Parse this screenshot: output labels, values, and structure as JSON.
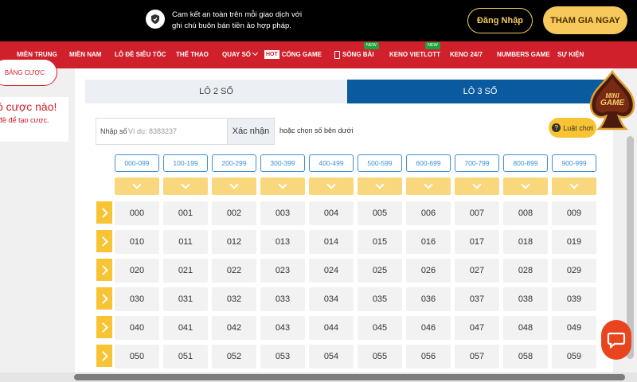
{
  "topbar": {
    "note": "Cam kết an toàn trên mỗi giao dịch với ghi chú buôn bán tiền ảo hợp pháp.",
    "login_label": "Đăng Nhập",
    "join_label": "THAM GIA NGAY",
    "accent": "#f7c95a"
  },
  "nav": {
    "bg": "#d0202b",
    "items": [
      {
        "label": "MIỀN TRUNG"
      },
      {
        "label": "MIỀN NAM"
      },
      {
        "label": "LÔ ĐỀ SIÊU TỐC"
      },
      {
        "label": "THỂ THAO"
      },
      {
        "label": "QUAY SỐ"
      },
      {
        "label": "CỔNG GAME",
        "tag": "HOT"
      },
      {
        "label": "SÒNG BÀI",
        "badge": "NEW"
      },
      {
        "label": "KENO VIETLOTT",
        "badge": "NEW"
      },
      {
        "label": "KENO 24/7"
      },
      {
        "label": "NUMBERS GAME"
      },
      {
        "label": "SỰ KIỆN"
      }
    ]
  },
  "sidebar": {
    "button_label": "BẢNG CƯỢC",
    "heading": "ó cược nào!",
    "subtext": "đề để tạo cược."
  },
  "tabs": [
    {
      "label": "LÔ 2 SỐ",
      "active": false
    },
    {
      "label": "LÔ 3 SỐ",
      "active": true
    }
  ],
  "input": {
    "label": "Nhập số",
    "placeholder": "Ví dụ: 8383237",
    "value": "",
    "confirm_label": "Xác nhận",
    "hint": "hoặc chọn số bên dưới"
  },
  "rules_label": "Luật chơi",
  "ranges": [
    "000-099",
    "100-199",
    "200-299",
    "300-399",
    "400-499",
    "500-599",
    "600-699",
    "700-799",
    "800-899",
    "900-999"
  ],
  "grid": [
    [
      "000",
      "001",
      "002",
      "003",
      "004",
      "005",
      "006",
      "007",
      "008",
      "009"
    ],
    [
      "010",
      "011",
      "012",
      "013",
      "014",
      "015",
      "016",
      "017",
      "018",
      "019"
    ],
    [
      "020",
      "021",
      "022",
      "023",
      "024",
      "025",
      "026",
      "027",
      "028",
      "029"
    ],
    [
      "030",
      "031",
      "032",
      "033",
      "034",
      "035",
      "036",
      "037",
      "038",
      "039"
    ],
    [
      "040",
      "041",
      "042",
      "043",
      "044",
      "045",
      "046",
      "047",
      "048",
      "049"
    ],
    [
      "050",
      "051",
      "052",
      "053",
      "054",
      "055",
      "056",
      "057",
      "058",
      "059"
    ]
  ],
  "minigame": {
    "line1": "MINI",
    "line2": "GAME"
  },
  "icons": [
    "shield-icon",
    "card-icon",
    "chevron-down-icon",
    "question-icon",
    "chat-icon"
  ]
}
